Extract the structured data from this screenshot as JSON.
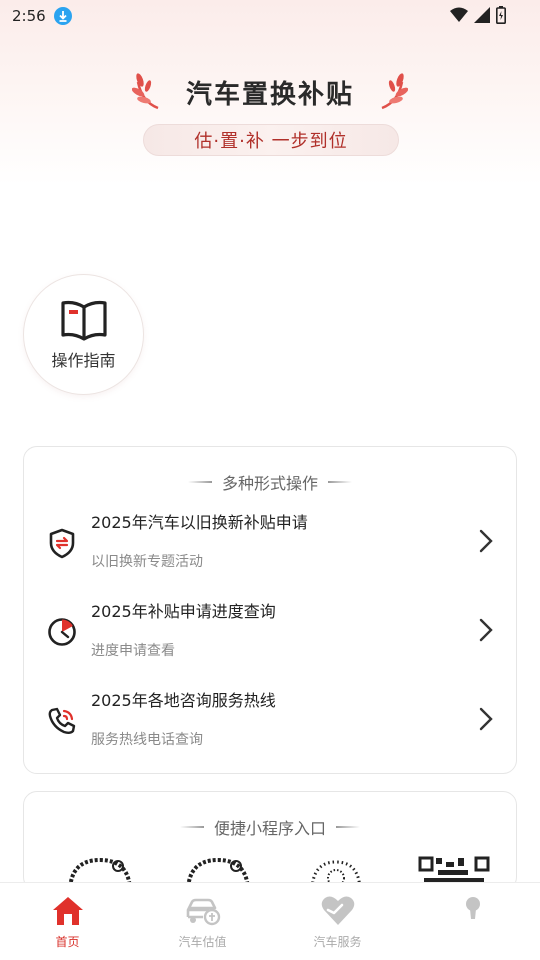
{
  "status_bar": {
    "time": "2:56"
  },
  "hero": {
    "title": "汽车置换补贴",
    "slogan": "估·置·补 一步到位"
  },
  "guide": {
    "label": "操作指南",
    "icon": "book-icon"
  },
  "operations": {
    "header": "多种形式操作",
    "items": [
      {
        "title": "2025年汽车以旧换新补贴申请",
        "subtitle": "以旧换新专题活动",
        "icon": "shield-exchange-icon"
      },
      {
        "title": "2025年补贴申请进度查询",
        "subtitle": "进度申请查看",
        "icon": "progress-clock-icon"
      },
      {
        "title": "2025年各地咨询服务热线",
        "subtitle": "服务热线电话查询",
        "icon": "phone-call-icon"
      }
    ]
  },
  "mini_programs": {
    "header": "便捷小程序入口"
  },
  "tabbar": {
    "items": [
      {
        "label": "首页",
        "icon": "home-icon",
        "active": true
      },
      {
        "label": "汽车估值",
        "icon": "car-valuation-icon",
        "active": false
      },
      {
        "label": "汽车服务",
        "icon": "heart-service-icon",
        "active": false
      },
      {
        "label": "",
        "icon": "profile-icon",
        "active": false
      }
    ]
  },
  "colors": {
    "accent": "#d8312b",
    "slogan_text": "#b0302a",
    "inactive": "#aaaaaa"
  }
}
